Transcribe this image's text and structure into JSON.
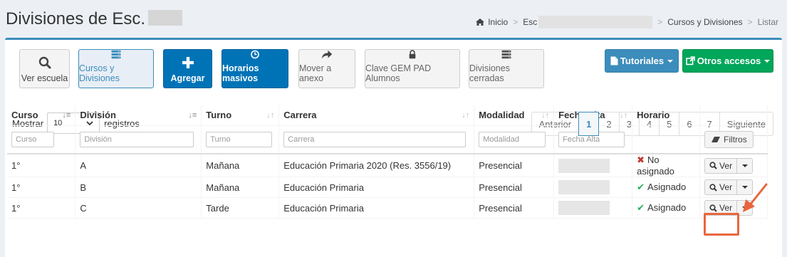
{
  "header": {
    "title": "Divisiones de Esc.",
    "breadcrumb": {
      "home": "Inicio",
      "school": "Esc",
      "section": "Cursos y Divisiones",
      "current": "Listar"
    }
  },
  "toolbar": {
    "ver_escuela": "Ver escuela",
    "cursos_divisiones": "Cursos y Divisiones",
    "agregar": "Agregar",
    "horarios_masivos": "Horarios masivos",
    "mover_anexo": "Mover a anexo",
    "clave_gem": "Clave GEM PAD Alumnos",
    "divisiones_cerradas": "Divisiones cerradas",
    "tutoriales": "Tutoriales",
    "otros_accesos": "Otros accesos"
  },
  "length": {
    "prefix": "Mostrar",
    "value": "10",
    "suffix": "registros"
  },
  "pagination": {
    "prev": "Anterior",
    "pages": [
      "1",
      "2",
      "3",
      "4",
      "5",
      "6",
      "7"
    ],
    "current": "1",
    "next": "Siguiente"
  },
  "table": {
    "headers": [
      "Curso",
      "División",
      "Turno",
      "Carrera",
      "Modalidad",
      "Fecha Alta",
      "Horario"
    ],
    "filters": [
      "Curso",
      "División",
      "Turno",
      "Carrera",
      "Modalidad",
      "Fecha Alta"
    ],
    "filtros_label": "Filtros",
    "ver_label": "Ver",
    "rows": [
      {
        "curso": "1°",
        "division": "A",
        "turno": "Mañana",
        "carrera": "Educación Primaria 2020 (Res. 3556/19)",
        "modalidad": "Presencial",
        "horario": "No asignado"
      },
      {
        "curso": "1°",
        "division": "B",
        "turno": "Mañana",
        "carrera": "Educación Primaria",
        "modalidad": "Presencial",
        "horario": "Asignado"
      },
      {
        "curso": "1°",
        "division": "C",
        "turno": "Tarde",
        "carrera": "Educación Primaria",
        "modalidad": "Presencial",
        "horario": "Asignado"
      }
    ]
  },
  "colors": {
    "primary": "#0073b7",
    "tutoriales": "#3c8dbc",
    "otros_accesos": "#00a65a",
    "highlight": "#e8663d"
  }
}
